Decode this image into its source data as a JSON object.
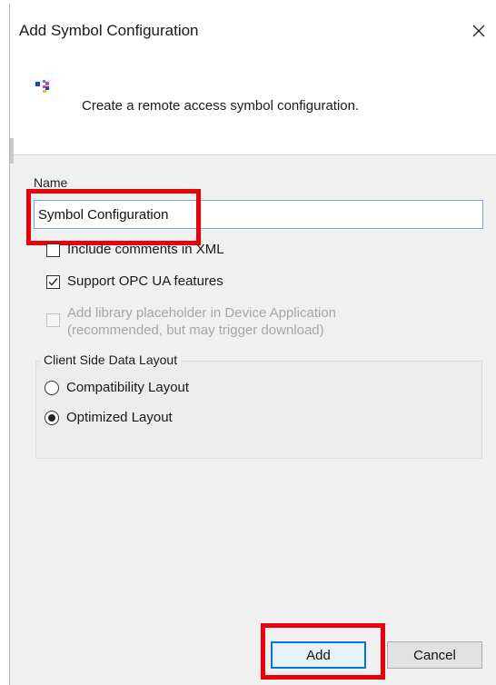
{
  "dialog": {
    "title": "Add Symbol Configuration",
    "close_icon": "close-icon",
    "header_icon": "symbol-configuration-icon",
    "header_text": "Create a remote access symbol configuration."
  },
  "form": {
    "name_label": "Name",
    "name_value": "Symbol Configuration",
    "options": {
      "include_comments": {
        "label": "Include comments in XML",
        "checked": false
      },
      "support_opc_ua": {
        "label": "Support OPC UA features",
        "checked": true
      },
      "add_library_placeholder": {
        "label_line1": "Add library placeholder in Device Application",
        "label_line2": "(recommended, but may trigger download)",
        "checked": false,
        "enabled": false
      }
    },
    "layout_group": {
      "legend": "Client Side Data Layout",
      "compatibility": {
        "label": "Compatibility Layout",
        "selected": false
      },
      "optimized": {
        "label": "Optimized Layout",
        "selected": true
      }
    }
  },
  "buttons": {
    "add": "Add",
    "cancel": "Cancel"
  },
  "colors": {
    "highlight": "#e8000b",
    "focus_border": "#0078d7"
  }
}
